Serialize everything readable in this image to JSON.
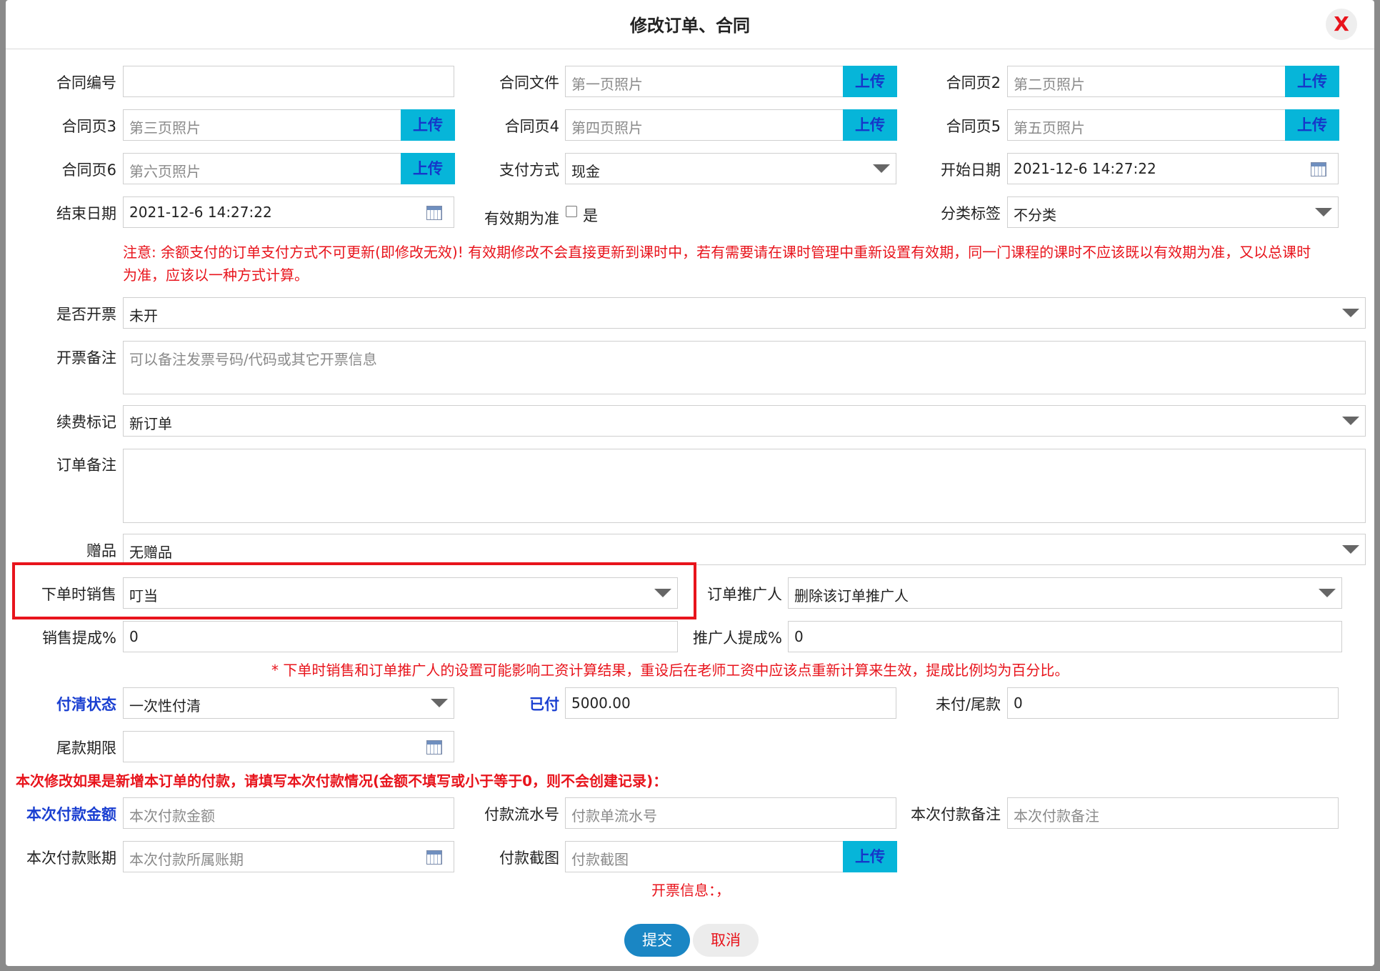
{
  "dialog": {
    "title": "修改订单、合同",
    "close_label": "X"
  },
  "upload_label": "上传",
  "fields": {
    "contract_no": {
      "label": "合同编号",
      "value": ""
    },
    "contract_file": {
      "label": "合同文件",
      "placeholder": "第一页照片"
    },
    "contract_p2": {
      "label": "合同页2",
      "placeholder": "第二页照片"
    },
    "contract_p3": {
      "label": "合同页3",
      "placeholder": "第三页照片"
    },
    "contract_p4": {
      "label": "合同页4",
      "placeholder": "第四页照片"
    },
    "contract_p5": {
      "label": "合同页5",
      "placeholder": "第五页照片"
    },
    "contract_p6": {
      "label": "合同页6",
      "placeholder": "第六页照片"
    },
    "payment_method": {
      "label": "支付方式",
      "value": "现金"
    },
    "start_date": {
      "label": "开始日期",
      "value": "2021-12-6 14:27:22"
    },
    "end_date": {
      "label": "结束日期",
      "value": "2021-12-6 14:27:22"
    },
    "validity_basis": {
      "label": "有效期为准",
      "option": "是"
    },
    "category_tag": {
      "label": "分类标签",
      "value": "不分类"
    },
    "invoice_issued": {
      "label": "是否开票",
      "value": "未开"
    },
    "invoice_note": {
      "label": "开票备注",
      "placeholder": "可以备注发票号码/代码或其它开票信息"
    },
    "renewal_mark": {
      "label": "续费标记",
      "value": "新订单"
    },
    "order_note": {
      "label": "订单备注",
      "value": ""
    },
    "gift": {
      "label": "赠品",
      "value": "无赠品"
    },
    "sales_at_order": {
      "label": "下单时销售",
      "value": "叮当"
    },
    "order_promoter": {
      "label": "订单推广人",
      "value": "删除该订单推广人"
    },
    "sales_commission": {
      "label": "销售提成%",
      "value": "0"
    },
    "promoter_commission": {
      "label": "推广人提成%",
      "value": "0"
    },
    "payoff_status": {
      "label": "付清状态",
      "value": "一次性付清"
    },
    "paid": {
      "label": "已付",
      "value": "5000.00"
    },
    "unpaid": {
      "label": "未付/尾款",
      "value": "0"
    },
    "balance_deadline": {
      "label": "尾款期限",
      "value": ""
    },
    "payment_amount": {
      "label": "本次付款金额",
      "placeholder": "本次付款金额"
    },
    "payment_serial": {
      "label": "付款流水号",
      "placeholder": "付款单流水号"
    },
    "payment_note": {
      "label": "本次付款备注",
      "placeholder": "本次付款备注"
    },
    "payment_period": {
      "label": "本次付款账期",
      "placeholder": "本次付款所属账期"
    },
    "payment_screenshot": {
      "label": "付款截图",
      "placeholder": "付款截图"
    }
  },
  "notes": {
    "validity_line1": "注意: 余额支付的订单支付方式不可更新(即修改无效)! 有效期修改不会直接更新到课时中，若有需要请在课时管理中重新设置有效期，同一门课程的课时不应该既以有效期为准，又以总课时",
    "validity_line2": "为准，应该以一种方式计算。",
    "commission": "* 下单时销售和订单推广人的设置可能影响工资计算结果，重设后在老师工资中应该点重新计算来生效，提成比例均为百分比。",
    "payment": "本次修改如果是新增本订单的付款，请填写本次付款情况(金额不填写或小于等于0，则不会创建记录)：",
    "invoice_info": "开票信息：，"
  },
  "buttons": {
    "submit": "提交",
    "cancel": "取消"
  },
  "colors": {
    "accent": "#1a86c4",
    "upload": "#06b5d9",
    "warning": "#e8141c",
    "label_blue": "#1a3fd1"
  }
}
